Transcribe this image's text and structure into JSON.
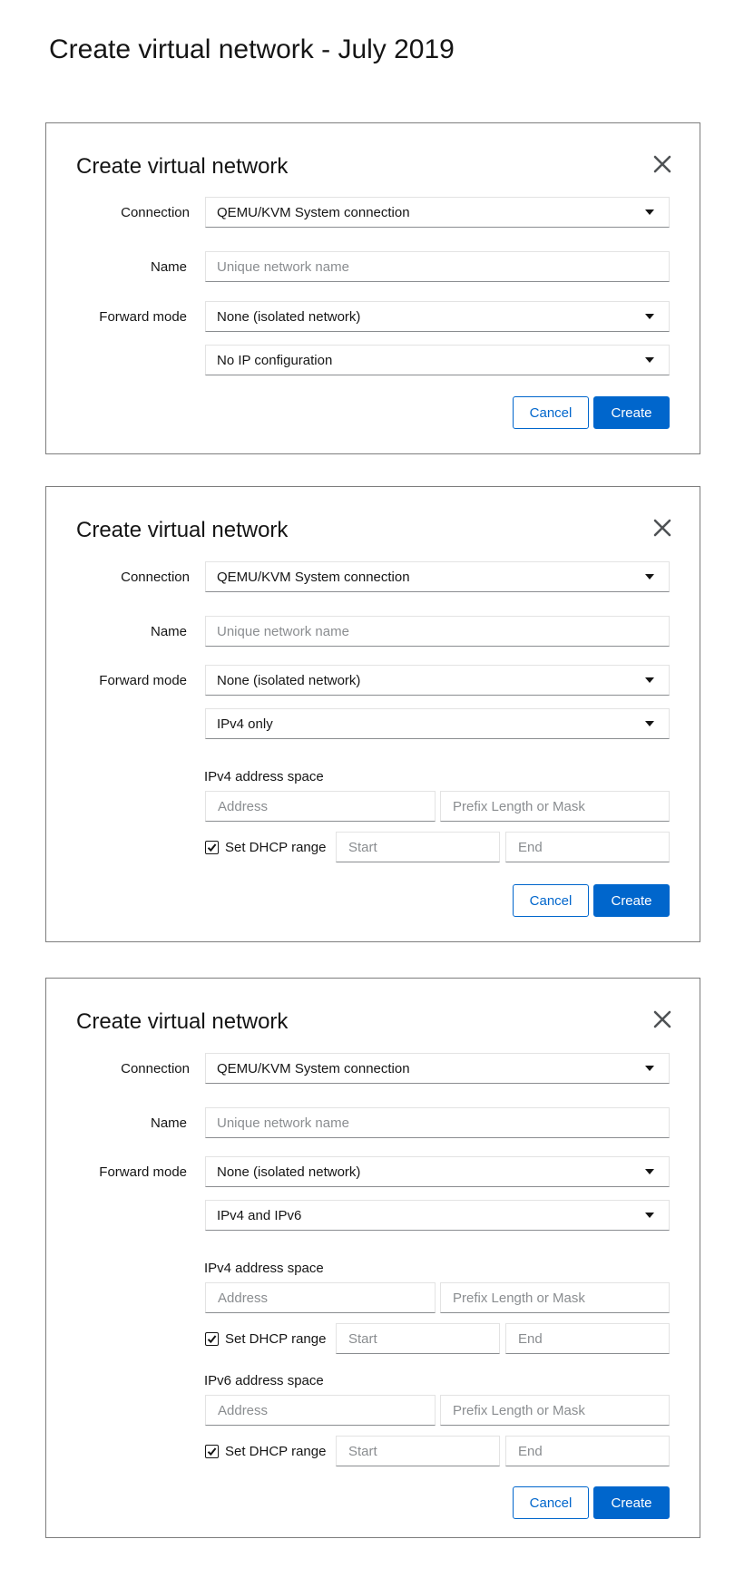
{
  "page": {
    "title": "Create virtual network - July 2019"
  },
  "dialog": {
    "title": "Create virtual network",
    "labels": {
      "connection": "Connection",
      "name": "Name",
      "forward_mode": "Forward mode"
    },
    "connection_value": "QEMU/KVM System connection",
    "name_placeholder": "Unique network name",
    "forward_mode_value": "None (isolated network)",
    "ip_options": {
      "none": "No IP configuration",
      "ipv4": "IPv4 only",
      "both": "IPv4 and IPv6"
    },
    "ipv4_label": "IPv4 address space",
    "ipv6_label": "IPv6 address space",
    "address_placeholder": "Address",
    "prefix_placeholder": "Prefix Length or Mask",
    "dhcp_label": "Set DHCP range",
    "start_placeholder": "Start",
    "end_placeholder": "End",
    "cancel_label": "Cancel",
    "create_label": "Create"
  },
  "icons": {
    "close": "close-icon",
    "dropdown": "caret-down-icon",
    "check": "checkmark-icon"
  },
  "colors": {
    "primary": "#0066cc",
    "border": "#7d7d7d",
    "placeholder": "#8a8d90"
  }
}
